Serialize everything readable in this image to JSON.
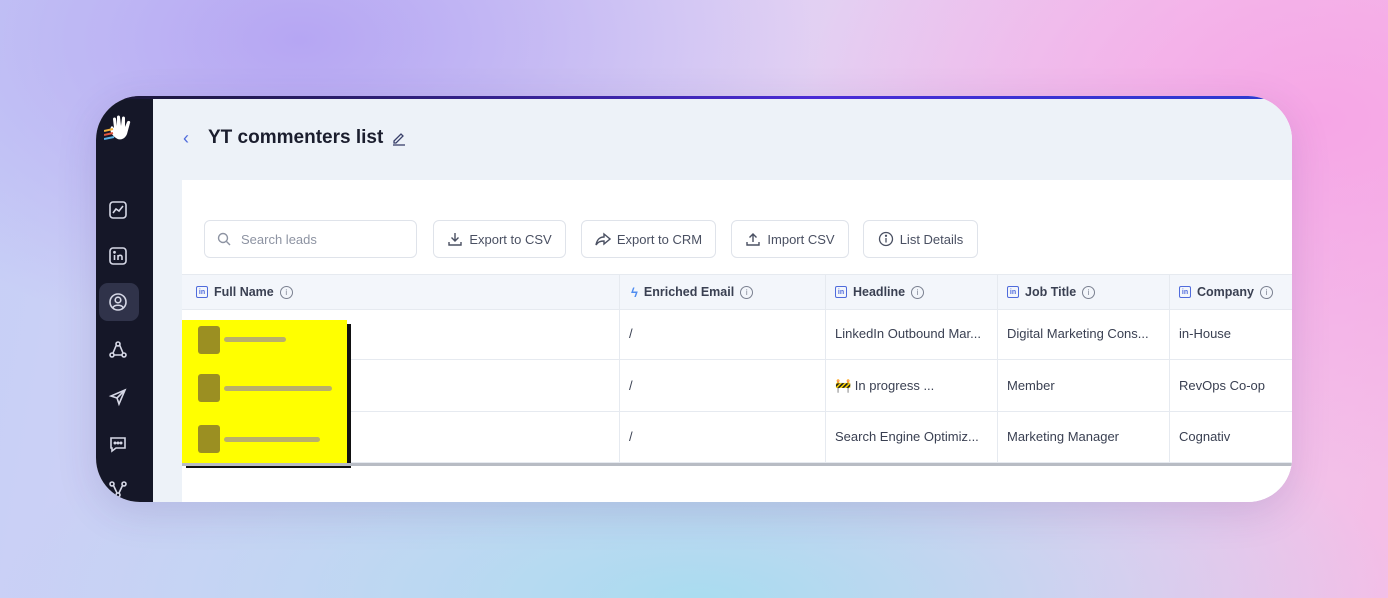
{
  "page": {
    "title": "YT commenters list"
  },
  "toolbar": {
    "search_placeholder": "Search leads",
    "export_csv": "Export to CSV",
    "export_crm": "Export to CRM",
    "import_csv": "Import CSV",
    "list_details": "List Details"
  },
  "table": {
    "columns": {
      "full_name": "Full Name",
      "enriched_email": "Enriched Email",
      "headline": "Headline",
      "job_title": "Job Title",
      "company": "Company"
    },
    "rows": [
      {
        "email": "/",
        "headline": "LinkedIn Outbound Mar...",
        "job_title": "Digital Marketing Cons...",
        "company": "in-House"
      },
      {
        "email": "/",
        "headline": "🚧 In progress ...",
        "job_title": "Member",
        "company": "RevOps Co-op"
      },
      {
        "email": "/",
        "headline": "Search Engine Optimiz...",
        "job_title": "Marketing Manager",
        "company": "Cognativ"
      }
    ]
  },
  "icons": {
    "sidebar": [
      "logo-hand-icon",
      "analytics-icon",
      "linkedin-icon",
      "contacts-icon",
      "network-icon",
      "send-icon",
      "messages-icon",
      "integrations-icon"
    ]
  },
  "colors": {
    "sidebar_bg": "#151728",
    "accent": "#4f6bdc",
    "redaction": "#ffff00"
  }
}
